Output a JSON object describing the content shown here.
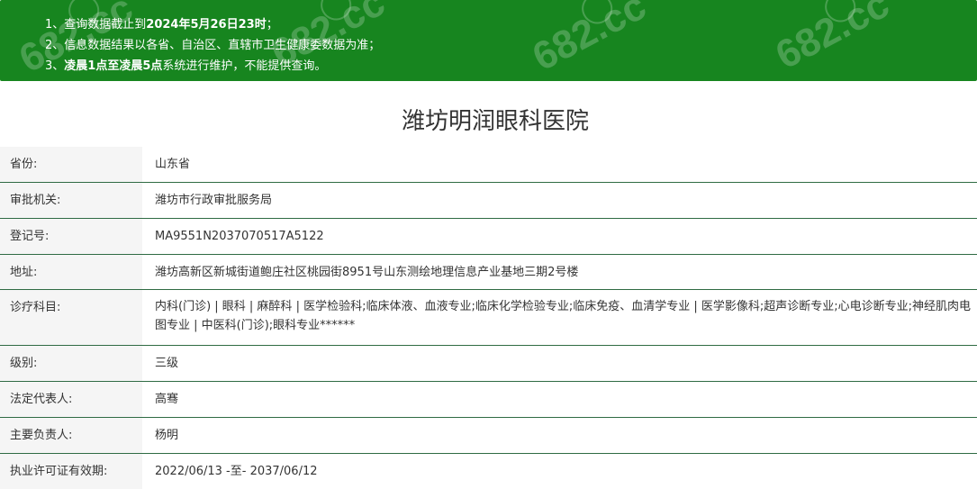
{
  "notice": {
    "line1_prefix": "1、查询数据截止到",
    "line1_bold": "2024年5月26日23时",
    "line1_suffix": "；",
    "line2": "2、信息数据结果以各省、自治区、直辖市卫生健康委数据为准；",
    "line3_prefix": "3、",
    "line3_bold": "凌晨1点至凌晨5点",
    "line3_suffix": "系统进行维护，不能提供查询。",
    "watermark": "682.cc"
  },
  "hospital": {
    "title": "潍坊明润眼科医院"
  },
  "details": [
    {
      "label": "省份:",
      "value": "山东省"
    },
    {
      "label": "审批机关:",
      "value": "潍坊市行政审批服务局"
    },
    {
      "label": "登记号:",
      "value": "MA9551N2037070517A5122"
    },
    {
      "label": "地址:",
      "value": "潍坊高新区新城街道鲍庄社区桃园街8951号山东测绘地理信息产业基地三期2号楼"
    },
    {
      "label": "诊疗科目:",
      "value": "内科(门诊) | 眼科 | 麻醉科 | 医学检验科;临床体液、血液专业;临床化学检验专业;临床免疫、血清学专业 | 医学影像科;超声诊断专业;心电诊断专业;神经肌肉电图专业 | 中医科(门诊);眼科专业******"
    },
    {
      "label": "级别:",
      "value": "三级"
    },
    {
      "label": "法定代表人:",
      "value": "高骞"
    },
    {
      "label": "主要负责人:",
      "value": "杨明"
    },
    {
      "label": "执业许可证有效期:",
      "value": "2022/06/13 -至- 2037/06/12"
    }
  ],
  "colors": {
    "banner": "#17851f",
    "row_border": "#2f6b43",
    "label_bg": "#f5f5f5"
  }
}
